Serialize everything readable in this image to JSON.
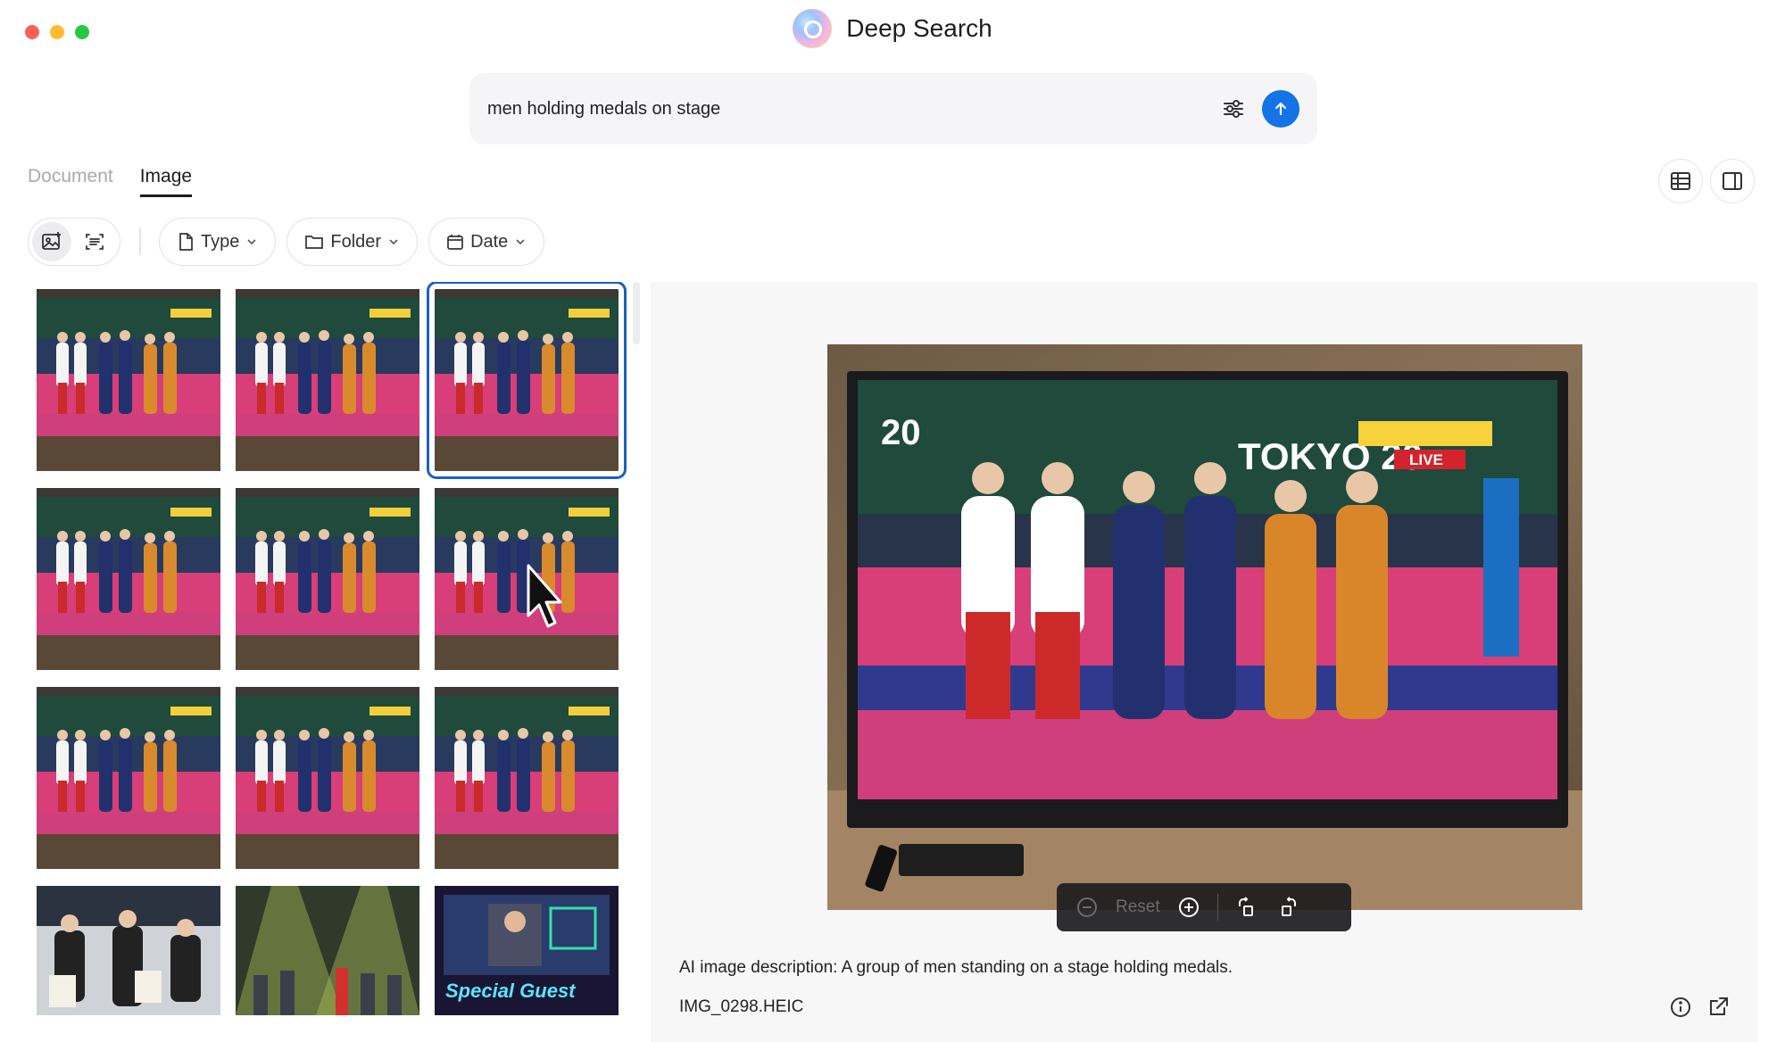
{
  "window": {
    "title": "Deep Search"
  },
  "search": {
    "value": "men holding medals on stage",
    "placeholder": ""
  },
  "tabs": [
    {
      "label": "Document",
      "active": false
    },
    {
      "label": "Image",
      "active": true
    }
  ],
  "filters": {
    "type_label": "Type",
    "folder_label": "Folder",
    "date_label": "Date"
  },
  "thumbnails": [
    {
      "scene": "podium"
    },
    {
      "scene": "podium"
    },
    {
      "scene": "podium",
      "selected": true
    },
    {
      "scene": "podium"
    },
    {
      "scene": "podium"
    },
    {
      "scene": "podium"
    },
    {
      "scene": "podium"
    },
    {
      "scene": "podium"
    },
    {
      "scene": "podium"
    },
    {
      "scene": "kids"
    },
    {
      "scene": "stage-lights"
    },
    {
      "scene": "special-guest"
    }
  ],
  "preview": {
    "zoom_reset_label": "Reset",
    "ai_description": "AI image description: A group of men standing on a stage holding medals.",
    "file_name": "IMG_0298.HEIC"
  },
  "colors": {
    "accent": "#1473e6",
    "selection": "#1d5fbf"
  }
}
